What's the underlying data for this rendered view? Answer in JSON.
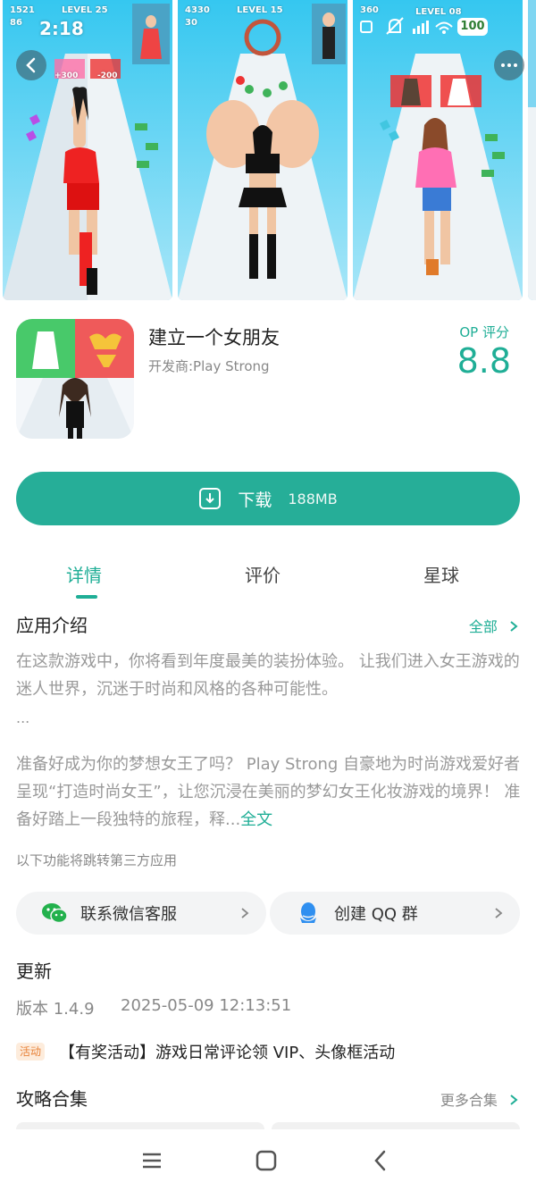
{
  "screenshots": {
    "s1": {
      "level": "LEVEL 25",
      "coins": "1521",
      "gems": "86",
      "gate_left": "+300",
      "gate_right": "-200"
    },
    "s2": {
      "level": "LEVEL 15",
      "coins": "4330",
      "gems": "30"
    },
    "s3": {
      "level": "LEVEL 08",
      "coins": "360",
      "gems": ""
    },
    "statusbar": {
      "time": "2:18",
      "battery": "100"
    }
  },
  "app": {
    "title": "建立一个女朋友",
    "developer": "开发商:Play Strong",
    "score_label": "OP 评分",
    "score": "8.8"
  },
  "download": {
    "label": "下载",
    "size": "188MB"
  },
  "tabs": [
    {
      "label": "详情",
      "active": true
    },
    {
      "label": "评价",
      "active": false
    },
    {
      "label": "星球",
      "active": false
    }
  ],
  "intro": {
    "title": "应用介绍",
    "more": "全部",
    "para1": "在这款游戏中，你将看到年度最美的装扮体验。 让我们进入女王游戏的迷人世界，沉迷于时尚和风格的各种可能性。",
    "ellipsis": "...",
    "para2": "准备好成为你的梦想女王了吗？ Play Strong 自豪地为时尚游戏爱好者呈现“打造时尚女王”，让您沉浸在美丽的梦幻女王化妆游戏的境界！ 准备好踏上一段独特的旅程，释...",
    "full_link": "全文",
    "note": "以下功能将跳转第三方应用"
  },
  "services": {
    "wechat": "联系微信客服",
    "qq": "创建 QQ 群"
  },
  "update": {
    "title": "更新",
    "version": "版本 1.4.9",
    "date": "2025-05-09 12:13:51",
    "badge": "活动",
    "activity": "【有奖活动】游戏日常评论领 VIP、头像框活动"
  },
  "guides": {
    "title": "攻略合集",
    "more": "更多合集"
  },
  "colors": {
    "accent": "#26ae98",
    "accent_text": "#1fae96",
    "badge_bg": "#fdecdc",
    "badge_text": "#e8833a"
  }
}
